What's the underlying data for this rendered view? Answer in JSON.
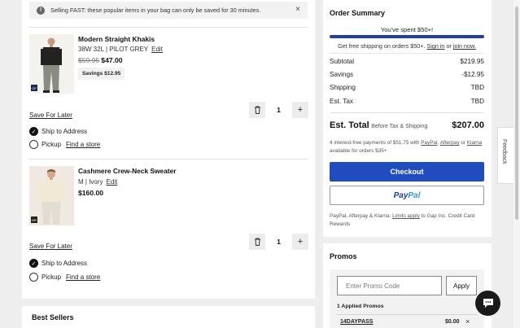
{
  "notice": {
    "text": "Selling FAST: these popular items in your bag can only be saved for 30 minutes.",
    "close_glyph": "×",
    "icon": "alert-icon"
  },
  "items": [
    {
      "name": "Modern Straight Khakis",
      "variant": "38W 32L | PILOT GREY",
      "edit": "Edit",
      "old_price": "$59.95",
      "price": "$47.00",
      "savings": "Savings $12.95",
      "brand_tag": "GF",
      "quantity": "1",
      "save_later": "Save For Later",
      "ship_label": "Ship to Address",
      "pickup_label": "Pickup",
      "find_store": "Find a store"
    },
    {
      "name": "Cashmere Crew-Neck Sweater",
      "variant": "M | Ivory",
      "edit": "Edit",
      "price": "$160.00",
      "brand_tag": "BR",
      "quantity": "1",
      "save_later": "Save For Later",
      "ship_label": "Ship to Address",
      "pickup_label": "Pickup",
      "find_store": "Find a store"
    }
  ],
  "best_sellers": "Best Sellers",
  "summary": {
    "title": "Order Summary",
    "spent_msg": "You've spent $50+!",
    "shipping_progress": 1.0,
    "free_ship_text": "Get free shipping on orders $50+.",
    "sign_in": "Sign in",
    "or": "or",
    "join_now": "join now.",
    "rows": [
      {
        "label": "Subtotal",
        "value": "$219.95"
      },
      {
        "label": "Savings",
        "value": "-$12.95"
      },
      {
        "label": "Shipping",
        "value": "TBD"
      },
      {
        "label": "Est. Tax",
        "value": "TBD"
      }
    ],
    "est_total_label": "Est. Total",
    "est_total_sub": "Before Tax & Shipping",
    "est_total_value": "$207.00",
    "installments_a": "4 interest-free payments of $51.75 with",
    "paypal_link": "PayPal",
    "afterpay_link": "Afterpay",
    "klarna_link": "Klarna",
    "installments_b": "available for orders $35+",
    "checkout": "Checkout",
    "paypal_btn_a": "Pay",
    "paypal_btn_b": "Pal",
    "disclaimer_a": "PayPal, Afterpay & Klarna:",
    "limits_apply": "Limits apply",
    "disclaimer_b": "to Gap Inc. Credit Card Rewards"
  },
  "promos": {
    "title": "Promos",
    "placeholder": "Enter Promo Code",
    "apply": "Apply",
    "applied_count": "1 Applied Promos",
    "code": "14DAYPASS",
    "code_value": "$0.00",
    "remove_glyph": "×"
  },
  "feedback": "Feedback",
  "colors": {
    "checkout_blue": "#1f4cbf",
    "progress_blue": "#1e3fa6"
  }
}
